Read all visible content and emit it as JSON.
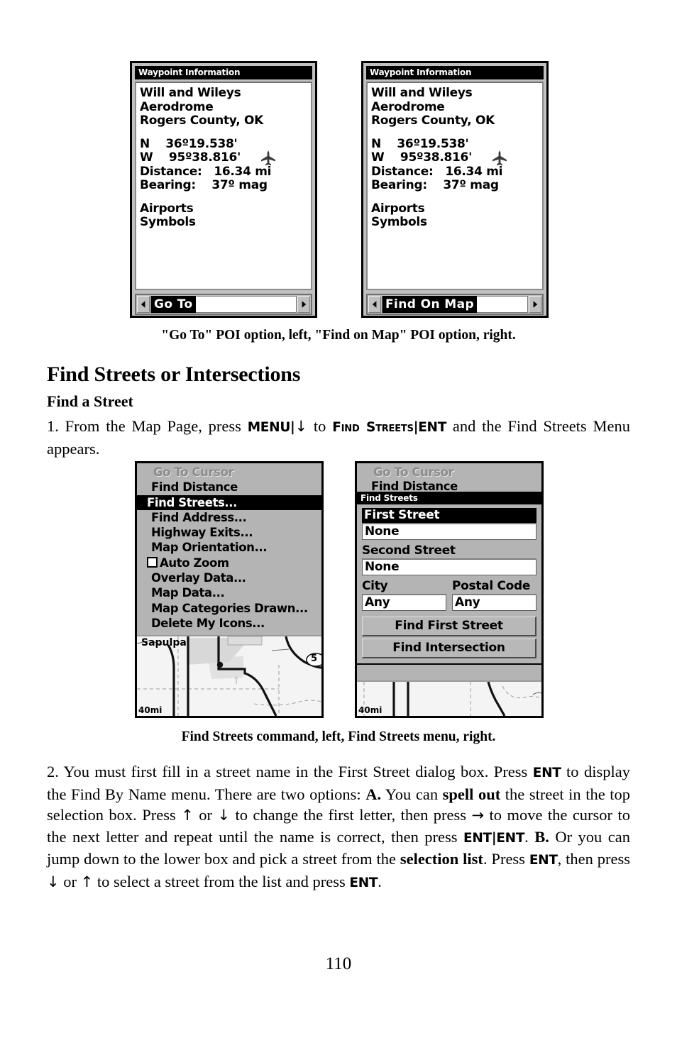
{
  "page": {
    "number": "110"
  },
  "figure1": {
    "caption": "\"Go To\" POI option, left, \"Find on Map\" POI option, right.",
    "screens": [
      {
        "title": "Waypoint Information",
        "lines": [
          "Will and Wileys",
          "Aerodrome",
          "Rogers County, OK"
        ],
        "coords": [
          "N    36º19.538'",
          "W    95º38.816'"
        ],
        "distance": "Distance:   16.34 mi",
        "bearing": "Bearing:    37º mag",
        "category": "Airports",
        "subcategory": "Symbols",
        "icon": "airplane-icon",
        "button_label": "Go To",
        "left_arrow": "◀",
        "right_arrow": "▶"
      },
      {
        "title": "Waypoint Information",
        "lines": [
          "Will and Wileys",
          "Aerodrome",
          "Rogers County, OK"
        ],
        "coords": [
          "N    36º19.538'",
          "W    95º38.816'"
        ],
        "distance": "Distance:   16.34 mi",
        "bearing": "Bearing:    37º mag",
        "category": "Airports",
        "subcategory": "Symbols",
        "icon": "airplane-icon",
        "button_label": "Find On Map",
        "left_arrow": "◀",
        "right_arrow": "▶"
      }
    ]
  },
  "section": {
    "heading": "Find Streets or Intersections",
    "subheading": "Find a Street"
  },
  "step1": {
    "a": "1. From the Map Page, press ",
    "key1": "MENU",
    "sep1": "|",
    "arrow_down": "↓",
    "b": " to ",
    "cmd": "Find Streets",
    "sep2": "|",
    "key2": "ENT",
    "c": " and the Find Streets Menu appears."
  },
  "figure2": {
    "caption": "Find Streets command, left, Find Streets menu, right.",
    "menu_screen": {
      "items": [
        {
          "label": "Go To Cursor",
          "state": "disabled"
        },
        {
          "label": "Find Distance",
          "state": "normal"
        },
        {
          "label": "Find Streets...",
          "state": "highlighted"
        },
        {
          "label": "Find Address...",
          "state": "normal"
        },
        {
          "label": "Highway Exits...",
          "state": "normal"
        },
        {
          "label": "Map Orientation...",
          "state": "normal"
        },
        {
          "label": "Auto Zoom",
          "state": "checkbox"
        },
        {
          "label": "Overlay Data...",
          "state": "normal"
        },
        {
          "label": "Map Data...",
          "state": "normal"
        },
        {
          "label": "Map Categories Drawn...",
          "state": "normal"
        },
        {
          "label": "Delete My Icons...",
          "state": "normal"
        }
      ],
      "map_city_label": "Sapulpa",
      "map_scale": "40mi",
      "map_route_shield": "5"
    },
    "dialog_screen": {
      "behind_items": [
        {
          "label": "Go To Cursor",
          "state": "disabled"
        },
        {
          "label": "Find Distance",
          "state": "normal"
        }
      ],
      "dialog_title": "Find Streets",
      "fields": [
        {
          "label": "First Street",
          "value": "None",
          "highlighted": true
        },
        {
          "label": "Second Street",
          "value": "None",
          "highlighted": false
        }
      ],
      "city": {
        "label": "City",
        "value": "Any"
      },
      "postal": {
        "label": "Postal Code",
        "value": "Any"
      },
      "buttons": [
        "Find First Street",
        "Find Intersection"
      ],
      "map_scale": "40mi"
    }
  },
  "step2": {
    "t1": "2. You must first fill in a street name in the First Street dialog box. Press ",
    "k1": "ENT",
    "t2": " to display the Find By Name menu. There are two options: ",
    "bA": "A.",
    "t3": " You can ",
    "bSpell": "spell out",
    "t4": " the street in the top selection box. Press ",
    "up1": "↑",
    "t5": " or ",
    "dn1": "↓",
    "t6": " to change the first letter, then press ",
    "right1": "→",
    "t7": " to move the cursor to the next letter and repeat until the name is correct, then press ",
    "k2": "ENT",
    "sep": "|",
    "k3": "ENT",
    "t8": ". ",
    "bB": "B.",
    "t9": " Or you can jump down to the lower box and pick a street from the ",
    "bSel": "selection list",
    "t10": ". Press ",
    "k4": "ENT",
    "t11": ", then press ",
    "dn2": "↓",
    "t12": " or ",
    "up2": "↑",
    "t13": " to select a street from the list and press ",
    "k5": "ENT",
    "t14": "."
  },
  "colors": {
    "screen_bg": "#c0c0c0",
    "menu_bg": "#b4b4b4",
    "highlight": "#000000",
    "field_bg": "#ffffff",
    "map_bg": "#f2f2f2"
  }
}
